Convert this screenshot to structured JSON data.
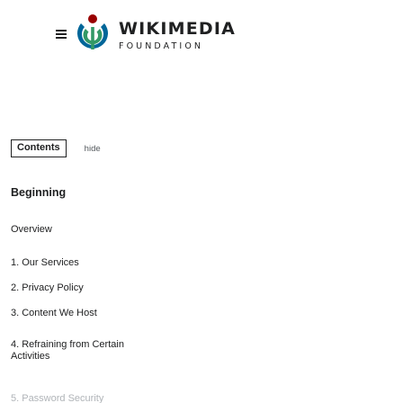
{
  "header": {
    "menu_icon": "hamburger-menu-icon",
    "logo_icon": "wikimedia-logo-icon",
    "title": "WIKIMEDIA",
    "subtitle": "FOUNDATION"
  },
  "toc": {
    "title": "Contents",
    "toggle": "hide",
    "items": [
      {
        "label": "Beginning"
      },
      {
        "label": "Overview"
      },
      {
        "label": "1. Our Services"
      },
      {
        "label": "2. Privacy Policy"
      },
      {
        "label": "3. Content We Host"
      },
      {
        "label": "4. Refraining from Certain Activities"
      },
      {
        "label": "5. Password Security"
      }
    ]
  },
  "colors": {
    "text": "#202122",
    "logo_red": "#990000",
    "logo_green": "#339966",
    "logo_blue": "#006699"
  }
}
